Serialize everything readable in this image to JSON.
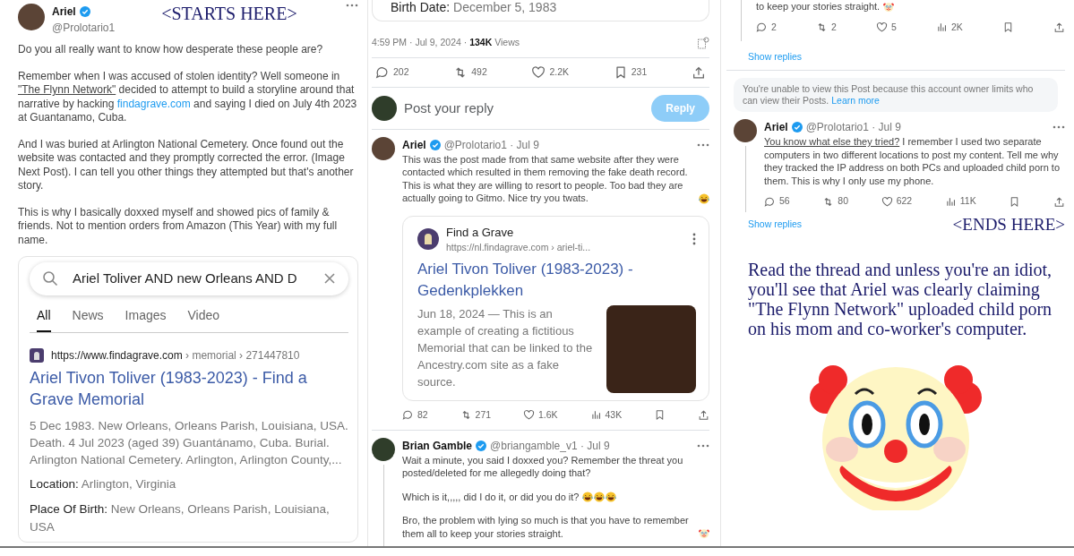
{
  "col1": {
    "annotation": "<STARTS HERE>",
    "post": {
      "author": "Ariel",
      "verified": true,
      "meta": "@Prolotario1",
      "paragraphs": [
        [
          {
            "kind": "text",
            "text": "Do you all really want to know how desperate these people are?"
          }
        ],
        [
          {
            "kind": "text",
            "text": "Remember when I was accused of stolen identity? Well someone in "
          },
          {
            "kind": "underline",
            "text": "\"The Flynn Network\""
          },
          {
            "kind": "text",
            "text": " decided to attempt to build a storyline around that narrative by hacking "
          },
          {
            "kind": "link",
            "text": "findagrave.com"
          },
          {
            "kind": "text",
            "text": " and saying I died on July 4th 2023 at  Guantanamo, Cuba."
          }
        ],
        [
          {
            "kind": "text",
            "text": "And I was buried at Arlington National Cemetery. Once found out the website was contacted and they promptly corrected the error. (Image Next Post). I can tell you other things they attempted but that's another story."
          }
        ],
        [
          {
            "kind": "text",
            "text": "This is why I basically doxxed myself and showed pics of family & friends. Not to mention orders from Amazon (This Year) with my full name."
          }
        ]
      ]
    },
    "search": {
      "query": "Ariel Toliver AND new Orleans AND D",
      "tabs": [
        {
          "label": "All",
          "selected": true
        },
        {
          "label": "News",
          "selected": false
        },
        {
          "label": "Images",
          "selected": false
        },
        {
          "label": "Video",
          "selected": false
        }
      ],
      "result": {
        "url": "https://www.findagrave.com",
        "path": " › memorial › 271447810",
        "title": "Ariel Tivon Toliver (1983-2023) - Find a Grave Memorial",
        "snippet": "5 Dec 1983. New Orleans, Orleans Parish, Louisiana, USA. Death. 4 Jul 2023 (aged 39) Guantánamo, Cuba. Burial. Arlington National Cemetery. Arlington, Arlington County,...",
        "facts": [
          {
            "label": "Location:",
            "value": "Arlington, Virginia"
          },
          {
            "label": "Place Of Birth:",
            "value": "New Orleans, Orleans Parish, Louisiana, USA"
          }
        ]
      }
    }
  },
  "col2": {
    "fragment": {
      "label": "Birth Date:",
      "value": "December 5, 1983"
    },
    "meta": "4:59 PM · Jul 9, 2024 · **134K** Views",
    "actions": [
      {
        "kind": "reply",
        "count": "202"
      },
      {
        "kind": "repost",
        "count": "492"
      },
      {
        "kind": "like",
        "count": "2.2K"
      },
      {
        "kind": "bookmark",
        "count": "231"
      },
      {
        "kind": "share"
      }
    ],
    "composer": {
      "placeholder": "Post your reply",
      "button": "Reply",
      "disabled": true
    },
    "posts": [
      {
        "author": "Ariel",
        "verified": true,
        "meta": "@Prolotario1 · Jul 9",
        "paragraphs": [
          [
            {
              "kind": "text",
              "text": "This was the post made from that same website after they were contacted which resulted in them removing the fake death record. This is what they are willing to resort to people. Too bad they are actually going to Gitmo. Nice try you twats."
            },
            {
              "kind": "laugh"
            }
          ]
        ],
        "card": {
          "site": "Find a Grave",
          "url": "https://nl.findagrave.com › ariel-ti...",
          "title": "Ariel Tivon Toliver (1983-2023) - Gedenkplekken",
          "snippet": "Jun 18, 2024 — This is an example of creating a fictitious Memorial that can be linked to the Ancestry.com site as a fake source."
        },
        "actions": [
          {
            "kind": "reply",
            "count": "82"
          },
          {
            "kind": "repost",
            "count": "271"
          },
          {
            "kind": "like",
            "count": "1.6K"
          },
          {
            "kind": "views",
            "count": "43K"
          },
          {
            "kind": "bookmark"
          },
          {
            "kind": "share"
          }
        ]
      },
      {
        "author": "Brian Gamble",
        "verified": true,
        "meta": "@briangamble_v1 · Jul 9",
        "paragraphs": [
          [
            {
              "kind": "text",
              "text": "Wait a minute, you said I doxxed you? Remember the threat you posted/deleted for me allegedly doing that?"
            }
          ],
          [
            {
              "kind": "text",
              "text": "Which is it,,,,, did I do it, or did you do it?"
            },
            {
              "kind": "laugh"
            },
            {
              "kind": "laugh"
            },
            {
              "kind": "laugh"
            }
          ],
          [
            {
              "kind": "text",
              "text": "Bro, the problem with lying so much is that you have to remember them all to keep your stories straight."
            },
            {
              "kind": "clown"
            }
          ]
        ]
      }
    ]
  },
  "col3": {
    "fragment": [
      {
        "kind": "text",
        "text": "to keep your stories straight."
      },
      {
        "kind": "clown"
      }
    ],
    "actions": [
      {
        "kind": "reply",
        "count": "2"
      },
      {
        "kind": "repost",
        "count": "2"
      },
      {
        "kind": "like",
        "count": "5"
      },
      {
        "kind": "views",
        "count": "2K"
      },
      {
        "kind": "bookmark"
      },
      {
        "kind": "share"
      }
    ],
    "show_replies": "Show replies",
    "notice": {
      "text": "You're unable to view this Post because this account owner limits who can view their Posts. ",
      "link": "Learn more"
    },
    "post": {
      "author": "Ariel",
      "verified": true,
      "meta": "@Prolotario1 · Jul 9",
      "paragraphs": [
        [
          {
            "kind": "underline",
            "text": "You know what else they tried?"
          },
          {
            "kind": "text",
            "text": " I remember I used two separate computers in two different locations to post my content. Tell me why they tracked the IP address on both PCs and uploaded child porn to them. This is why I only use my phone."
          }
        ]
      ],
      "actions": [
        {
          "kind": "reply",
          "count": "56"
        },
        {
          "kind": "repost",
          "count": "80"
        },
        {
          "kind": "like",
          "count": "622"
        },
        {
          "kind": "views",
          "count": "11K"
        },
        {
          "kind": "bookmark"
        },
        {
          "kind": "share"
        }
      ]
    },
    "show_replies_2": "Show replies",
    "annotation": "<ENDS HERE>",
    "commentary": "Read the thread and unless you're an idiot, you'll see that Ariel was clearly claiming \"The Flynn Network\" uploaded child porn on his mom and co-worker's computer."
  }
}
